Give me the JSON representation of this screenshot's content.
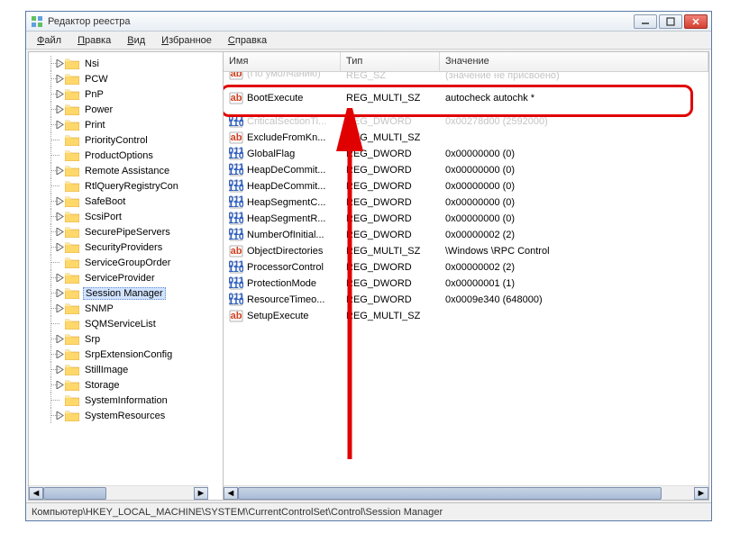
{
  "window": {
    "title": "Редактор реестра"
  },
  "menu": [
    "Файл",
    "Правка",
    "Вид",
    "Избранное",
    "Справка"
  ],
  "columns": {
    "name": "Имя",
    "type": "Тип",
    "value": "Значение"
  },
  "tree": [
    {
      "label": "Nsi",
      "expandable": true
    },
    {
      "label": "PCW",
      "expandable": true
    },
    {
      "label": "PnP",
      "expandable": true
    },
    {
      "label": "Power",
      "expandable": true
    },
    {
      "label": "Print",
      "expandable": true
    },
    {
      "label": "PriorityControl",
      "expandable": false
    },
    {
      "label": "ProductOptions",
      "expandable": false
    },
    {
      "label": "Remote Assistance",
      "expandable": true
    },
    {
      "label": "RtlQueryRegistryCon",
      "expandable": false
    },
    {
      "label": "SafeBoot",
      "expandable": true
    },
    {
      "label": "ScsiPort",
      "expandable": true
    },
    {
      "label": "SecurePipeServers",
      "expandable": true
    },
    {
      "label": "SecurityProviders",
      "expandable": true
    },
    {
      "label": "ServiceGroupOrder",
      "expandable": false
    },
    {
      "label": "ServiceProvider",
      "expandable": true
    },
    {
      "label": "Session Manager",
      "expandable": true,
      "selected": true
    },
    {
      "label": "SNMP",
      "expandable": true
    },
    {
      "label": "SQMServiceList",
      "expandable": false
    },
    {
      "label": "Srp",
      "expandable": true
    },
    {
      "label": "SrpExtensionConfig",
      "expandable": true
    },
    {
      "label": "StillImage",
      "expandable": true
    },
    {
      "label": "Storage",
      "expandable": true
    },
    {
      "label": "SystemInformation",
      "expandable": false
    },
    {
      "label": "SystemResources",
      "expandable": true
    }
  ],
  "rows_top_faded": {
    "name": "(По умолчанию)",
    "type": "REG_SZ",
    "value": "(значение не присвоено)"
  },
  "row_highlighted": {
    "name": "BootExecute",
    "type": "REG_MULTI_SZ",
    "value": "autocheck autochk *",
    "icon": "ab"
  },
  "rows": [
    {
      "name": "CriticalSectionTi...",
      "type": "REG_DWORD",
      "value": "0x00278d00 (2592000)",
      "icon": "num",
      "faded": true
    },
    {
      "name": "ExcludeFromKn...",
      "type": "REG_MULTI_SZ",
      "value": "",
      "icon": "ab"
    },
    {
      "name": "GlobalFlag",
      "type": "REG_DWORD",
      "value": "0x00000000 (0)",
      "icon": "num"
    },
    {
      "name": "HeapDeCommit...",
      "type": "REG_DWORD",
      "value": "0x00000000 (0)",
      "icon": "num"
    },
    {
      "name": "HeapDeCommit...",
      "type": "REG_DWORD",
      "value": "0x00000000 (0)",
      "icon": "num"
    },
    {
      "name": "HeapSegmentC...",
      "type": "REG_DWORD",
      "value": "0x00000000 (0)",
      "icon": "num"
    },
    {
      "name": "HeapSegmentR...",
      "type": "REG_DWORD",
      "value": "0x00000000 (0)",
      "icon": "num"
    },
    {
      "name": "NumberOfInitial...",
      "type": "REG_DWORD",
      "value": "0x00000002 (2)",
      "icon": "num"
    },
    {
      "name": "ObjectDirectories",
      "type": "REG_MULTI_SZ",
      "value": "\\Windows \\RPC Control",
      "icon": "ab"
    },
    {
      "name": "ProcessorControl",
      "type": "REG_DWORD",
      "value": "0x00000002 (2)",
      "icon": "num"
    },
    {
      "name": "ProtectionMode",
      "type": "REG_DWORD",
      "value": "0x00000001 (1)",
      "icon": "num"
    },
    {
      "name": "ResourceTimeo...",
      "type": "REG_DWORD",
      "value": "0x0009e340 (648000)",
      "icon": "num"
    },
    {
      "name": "SetupExecute",
      "type": "REG_MULTI_SZ",
      "value": "",
      "icon": "ab"
    }
  ],
  "statusbar": "Компьютер\\HKEY_LOCAL_MACHINE\\SYSTEM\\CurrentControlSet\\Control\\Session Manager"
}
